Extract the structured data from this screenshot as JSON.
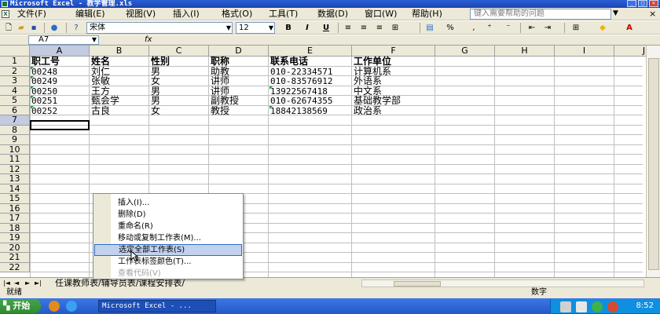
{
  "window": {
    "title": "Microsoft Excel - 教学管理.xls",
    "min_label": "_",
    "max_label": "□",
    "close_label": "×"
  },
  "menubar": {
    "items": [
      "文件(F)",
      "编辑(E)",
      "视图(V)",
      "插入(I)",
      "格式(O)",
      "工具(T)",
      "数据(D)",
      "窗口(W)",
      "帮助(H)"
    ],
    "help_placeholder": "键入需要帮助的问题",
    "help_arrow": "▼",
    "doc_close": "×"
  },
  "toolbar": {
    "font_name": "宋体",
    "font_size": "12",
    "bold": "B",
    "italic": "I",
    "underline": "U",
    "percent": "%",
    "font_color_label": "A"
  },
  "formula_bar": {
    "name_box": "A7",
    "fx_label": "fx"
  },
  "sheet": {
    "columns": [
      "A",
      "B",
      "C",
      "D",
      "E",
      "F",
      "G",
      "H",
      "I",
      "J"
    ],
    "selected_column": "A",
    "rows": [
      "1",
      "2",
      "3",
      "4",
      "5",
      "6",
      "7",
      "8",
      "9",
      "10",
      "11",
      "12",
      "13",
      "14",
      "15",
      "16",
      "17",
      "18",
      "19",
      "20",
      "21",
      "22"
    ],
    "selected_row": "7",
    "active_cell": "A7",
    "headers": [
      "职工号",
      "姓名",
      "性别",
      "职称",
      "联系电话",
      "工作单位"
    ],
    "data": [
      [
        "00248",
        "刘仁",
        "男",
        "助教",
        "010-22334571",
        "计算机系"
      ],
      [
        "00249",
        "张敏",
        "女",
        "讲师",
        "010-83576912",
        "外语系"
      ],
      [
        "00250",
        "王方",
        "男",
        "讲师",
        "13922567418",
        "中文系"
      ],
      [
        "00251",
        "甄会学",
        "男",
        "副教授",
        "010-62674355",
        "基础教学部"
      ],
      [
        "00252",
        "古良",
        "女",
        "教授",
        "18842138569",
        "政治系"
      ]
    ]
  },
  "sheet_tabs": {
    "nav": [
      "|◄",
      "◄",
      "►",
      "►|"
    ],
    "label": "任课教师表/辅导员表/课程安排表/"
  },
  "status": {
    "left": "就绪",
    "right": "数字"
  },
  "context_menu": {
    "items": [
      {
        "label": "插入(I)...",
        "state": "normal"
      },
      {
        "label": "删除(D)",
        "state": "normal"
      },
      {
        "label": "重命名(R)",
        "state": "normal"
      },
      {
        "label": "移动或复制工作表(M)...",
        "state": "normal"
      },
      {
        "label": "选定全部工作表(S)",
        "state": "highlighted"
      },
      {
        "label": "工作表标签颜色(T)...",
        "state": "normal"
      },
      {
        "label": "查看代码(V)",
        "state": "disabled"
      }
    ]
  },
  "taskbar": {
    "start_label": "开始",
    "task_label": "Microsoft Excel - ...",
    "clock": "8:52"
  }
}
